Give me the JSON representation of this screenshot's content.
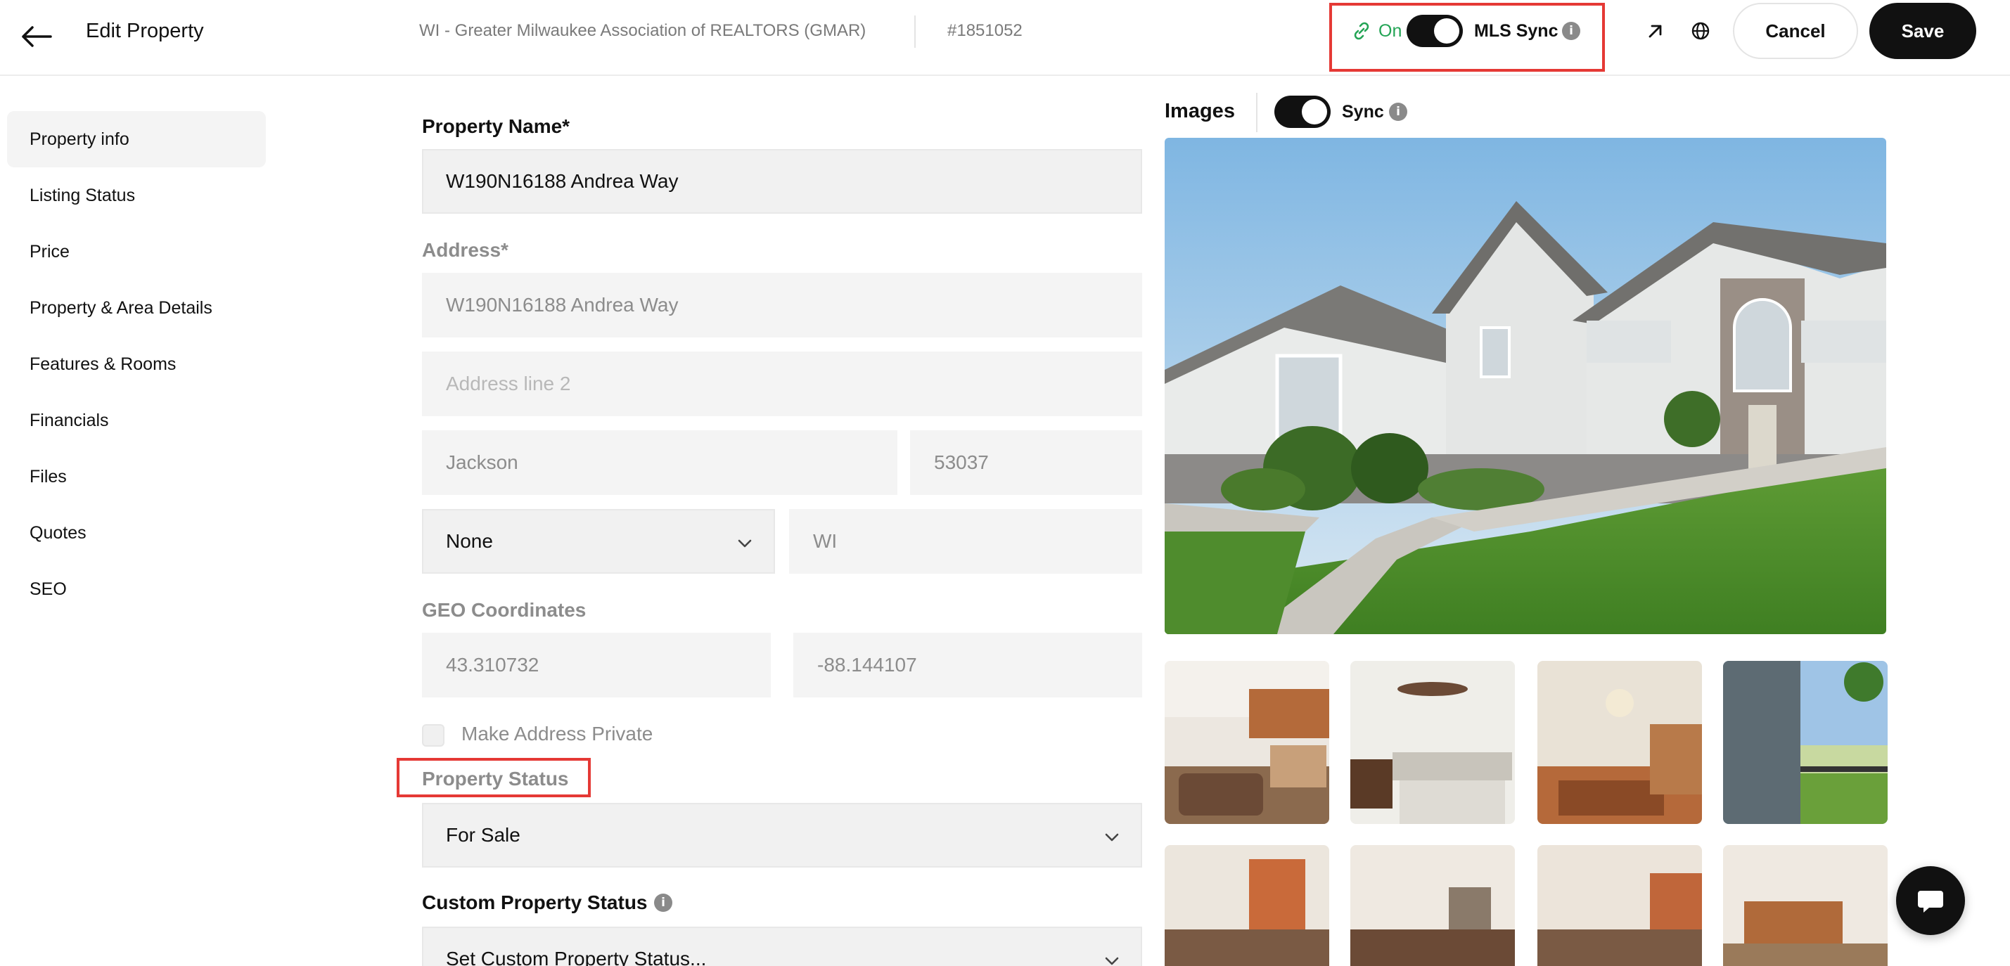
{
  "header": {
    "title": "Edit Property",
    "mls_association": "WI - Greater Milwaukee Association of REALTORS (GMAR)",
    "mls_number": "#1851052",
    "mls_sync_state": "On",
    "mls_sync_label": "MLS Sync",
    "cancel_label": "Cancel",
    "save_label": "Save"
  },
  "sidebar": {
    "items": [
      {
        "label": "Property info"
      },
      {
        "label": "Listing Status"
      },
      {
        "label": "Price"
      },
      {
        "label": "Property & Area Details"
      },
      {
        "label": "Features & Rooms"
      },
      {
        "label": "Financials"
      },
      {
        "label": "Files"
      },
      {
        "label": "Quotes"
      },
      {
        "label": "SEO"
      }
    ]
  },
  "form": {
    "property_name_label": "Property Name*",
    "property_name_value": "W190N16188 Andrea Way",
    "address_label": "Address*",
    "address_line1": "W190N16188 Andrea Way",
    "address_line2_placeholder": "Address line 2",
    "city": "Jackson",
    "zip": "53037",
    "county_select": "None",
    "state": "WI",
    "geo_label": "GEO Coordinates",
    "latitude": "43.310732",
    "longitude": "-88.144107",
    "private_label": "Make Address Private",
    "status_label": "Property Status",
    "status_value": "For Sale",
    "custom_status_label": "Custom Property Status",
    "custom_status_placeholder": "Set Custom Property Status..."
  },
  "images": {
    "title": "Images",
    "sync_label": "Sync"
  },
  "colors": {
    "accent_dark": "#111111",
    "sync_green": "#23a455",
    "highlight_red": "#e53935"
  },
  "icons": {
    "back": "arrow-left-icon",
    "link": "link-icon",
    "external": "arrow-up-right-icon",
    "globe": "globe-icon",
    "info": "info-icon",
    "chevron": "chevron-down-icon",
    "chat": "chat-bubble-icon"
  }
}
